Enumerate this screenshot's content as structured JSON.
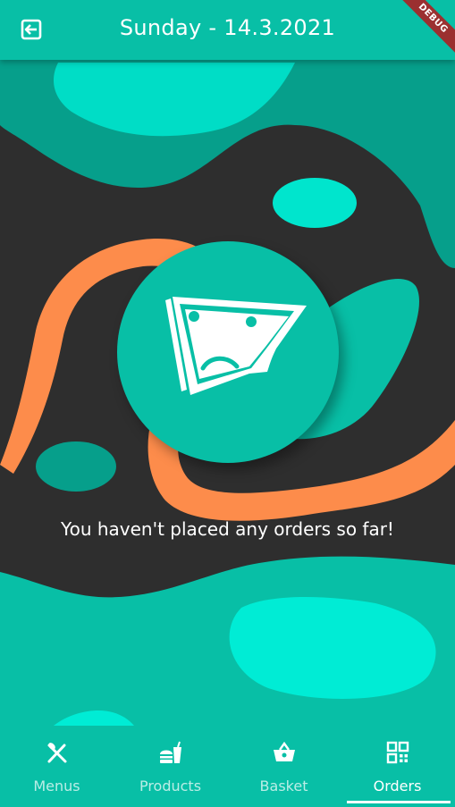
{
  "header": {
    "title": "Sunday - 14.3.2021",
    "debug_banner": "DEBUG",
    "back_icon": "exit-icon"
  },
  "empty_state": {
    "message": "You haven't placed any orders so far!",
    "icon": "sad-ticket-icon"
  },
  "colors": {
    "primary": "#08bfa6",
    "accent_orange": "#fd8c4b",
    "background_dark": "#2e2e2e",
    "light_teal": "#00ecd5"
  },
  "bottom_nav": {
    "items": [
      {
        "label": "Menus",
        "icon": "fork-knife-icon"
      },
      {
        "label": "Products",
        "icon": "burger-drink-icon"
      },
      {
        "label": "Basket",
        "icon": "basket-icon"
      },
      {
        "label": "Orders",
        "icon": "qr-code-icon"
      }
    ],
    "active": "Orders"
  }
}
